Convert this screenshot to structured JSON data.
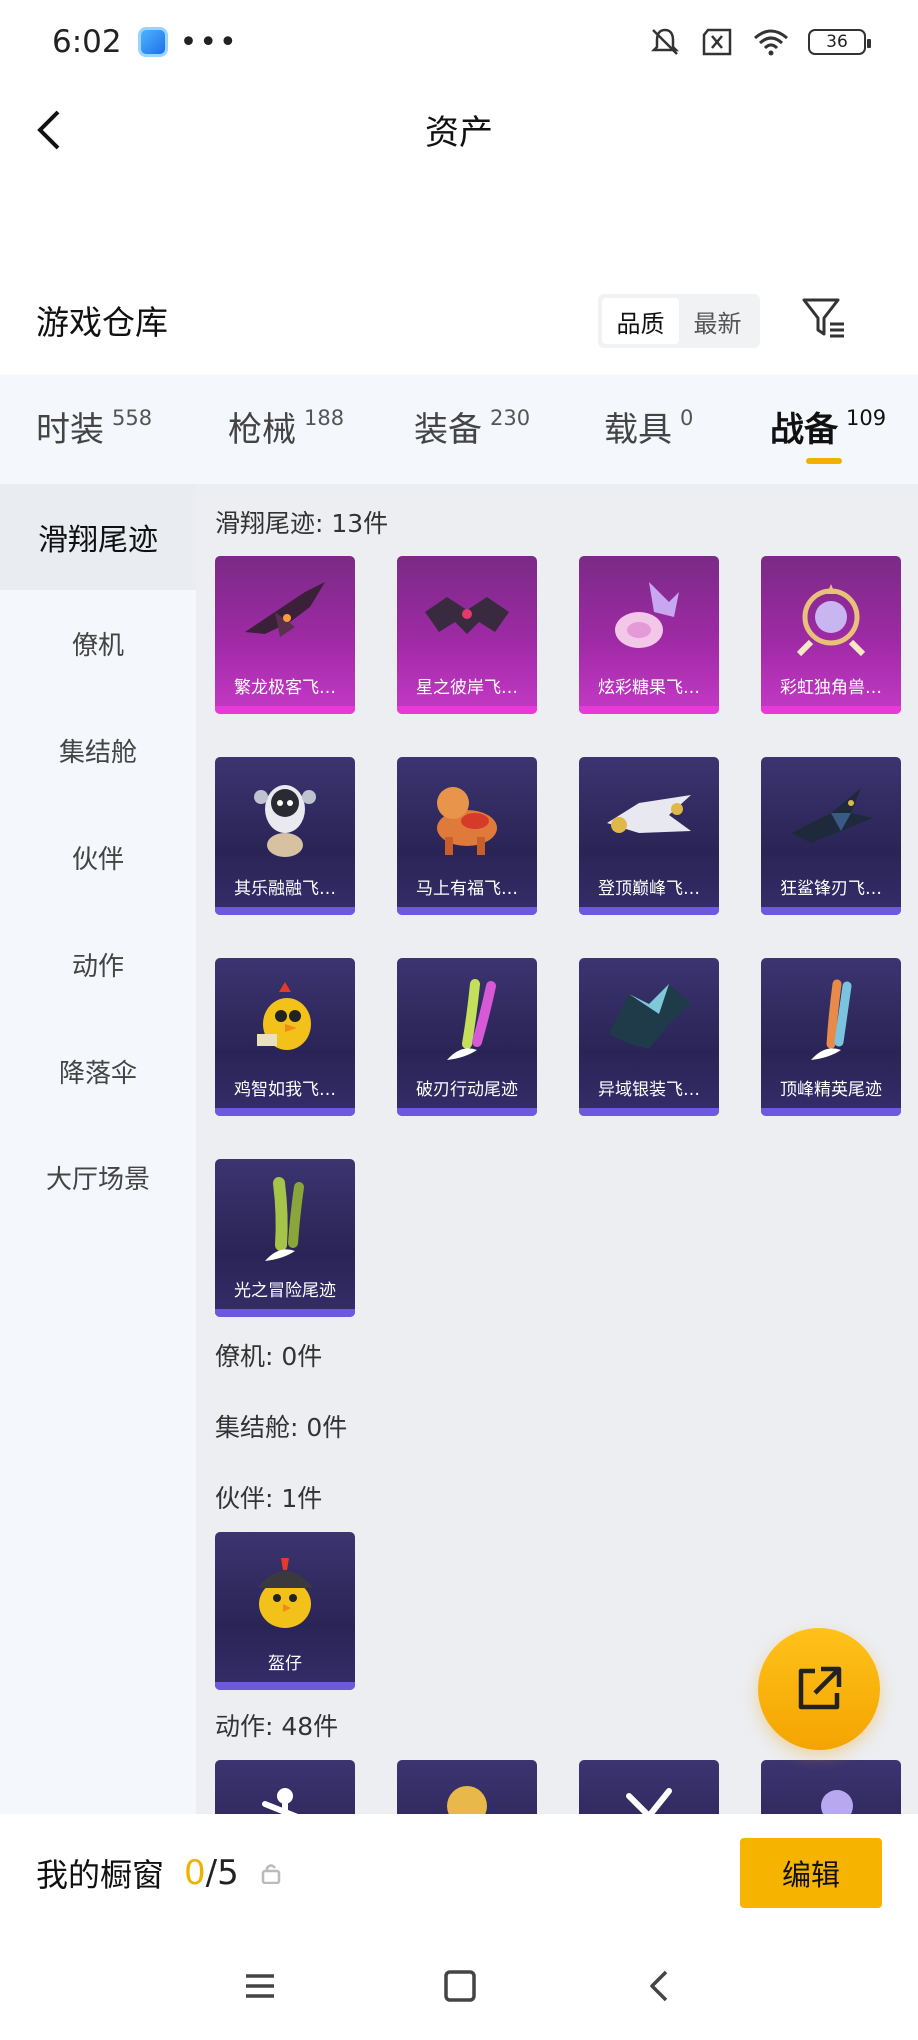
{
  "status_bar": {
    "time": "6:02",
    "battery": "36"
  },
  "header": {
    "title": "资产"
  },
  "warehouse": {
    "title": "游戏仓库",
    "sort_options": [
      "品质",
      "最新"
    ],
    "active_sort": "品质"
  },
  "tabs": [
    {
      "label": "时装",
      "count": "558"
    },
    {
      "label": "枪械",
      "count": "188"
    },
    {
      "label": "装备",
      "count": "230"
    },
    {
      "label": "载具",
      "count": "0"
    },
    {
      "label": "战备",
      "count": "109"
    }
  ],
  "active_tab": "战备",
  "subnav": [
    {
      "label": "滑翔尾迹"
    },
    {
      "label": "僚机"
    },
    {
      "label": "集结舱"
    },
    {
      "label": "伙伴"
    },
    {
      "label": "动作"
    },
    {
      "label": "降落伞"
    },
    {
      "label": "大厅场景"
    }
  ],
  "sections": {
    "glide_trails": {
      "label": "滑翔尾迹: 13件",
      "items": [
        {
          "name": "繁龙极客飞…",
          "color": "pink"
        },
        {
          "name": "星之彼岸飞…",
          "color": "pink"
        },
        {
          "name": "炫彩糖果飞…",
          "color": "pink"
        },
        {
          "name": "彩虹独角兽…",
          "color": "pink"
        },
        {
          "name": "其乐融融飞…",
          "color": "purple"
        },
        {
          "name": "马上有福飞…",
          "color": "purple"
        },
        {
          "name": "登顶巅峰飞…",
          "color": "purple"
        },
        {
          "name": "狂鲨锋刃飞…",
          "color": "purple"
        },
        {
          "name": "鸡智如我飞…",
          "color": "purple"
        },
        {
          "name": "破刃行动尾迹",
          "color": "purple"
        },
        {
          "name": "异域银装飞…",
          "color": "purple"
        },
        {
          "name": "顶峰精英尾迹",
          "color": "purple"
        },
        {
          "name": "光之冒险尾迹",
          "color": "purple"
        }
      ]
    },
    "wingman": {
      "label": "僚机: 0件"
    },
    "assembly_pod": {
      "label": "集结舱: 0件"
    },
    "companion": {
      "label": "伙伴: 1件",
      "items": [
        {
          "name": "盔仔",
          "color": "purple"
        }
      ]
    },
    "actions": {
      "label": "动作: 48件"
    }
  },
  "showcase": {
    "title": "我的橱窗",
    "used": "0",
    "total": "/5",
    "edit_label": "编辑"
  },
  "colors": {
    "accent": "#f6b400",
    "card_purple": "#2f2860",
    "card_pink": "#b432b4"
  }
}
